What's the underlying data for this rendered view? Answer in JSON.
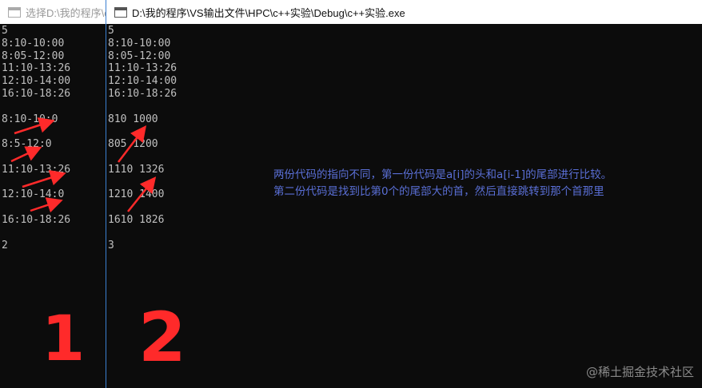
{
  "window1": {
    "title": "选择D:\\我的程序\\c",
    "lines": [
      "5",
      "8:10-10:00",
      "8:05-12:00",
      "11:10-13:26",
      "12:10-14:00",
      "16:10-18:26",
      "",
      "8:10-10:0",
      "",
      "8:5-12:0",
      "",
      "11:10-13:26",
      "",
      "12:10-14:0",
      "",
      "16:10-18:26",
      "",
      "2"
    ]
  },
  "window2": {
    "title": "D:\\我的程序\\VS输出文件\\HPC\\c++实验\\Debug\\c++实验.exe",
    "lines": [
      "5",
      "8:10-10:00",
      "8:05-12:00",
      "11:10-13:26",
      "12:10-14:00",
      "16:10-18:26",
      "",
      "810 1000",
      "",
      "805 1200",
      "",
      "1110 1326",
      "",
      "1210 1400",
      "",
      "1610 1826",
      "",
      "3"
    ]
  },
  "annotation": {
    "line1": "两份代码的指向不同，第一份代码是a[i]的头和a[i-1]的尾部进行比较。",
    "line2": "第二份代码是找到比第0个的尾部大的首，然后直接跳转到那个首那里"
  },
  "handwritten": {
    "label1": "1",
    "label2": "2"
  },
  "watermark": "@稀土掘金技术社区",
  "colors": {
    "arrow": "#ff2a2a",
    "annotation": "#5a6fd6",
    "console_text": "#c0c0c0",
    "background": "#0c0c0c"
  }
}
